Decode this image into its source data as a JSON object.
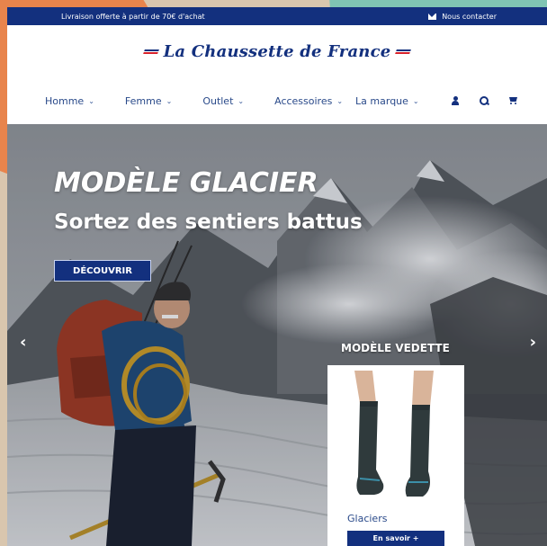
{
  "topbar": {
    "shipping_text": "Livraison offerte à partir de 70€ d'achat",
    "contact_label": "Nous contacter"
  },
  "logo": {
    "text": "La Chaussette de France"
  },
  "nav": {
    "items": [
      {
        "label": "Homme"
      },
      {
        "label": "Femme"
      },
      {
        "label": "Outlet"
      },
      {
        "label": "Accessoires"
      },
      {
        "label": "La marque"
      }
    ],
    "chevron": "⌄"
  },
  "icons": [
    "user-icon",
    "search-icon",
    "cart-icon",
    "mail-icon",
    "chevron-left-icon",
    "chevron-right-icon"
  ],
  "hero": {
    "title": "MODÈLE GLACIER",
    "subtitle": "Sortez des sentiers battus",
    "cta_label": "DÉCOUVRIR",
    "prev_arrow": "‹",
    "next_arrow": "›"
  },
  "featured": {
    "label": "MODÈLE VEDETTE",
    "product_name": "Glaciers",
    "cta_label": "En savoir +"
  },
  "colors": {
    "brand_navy": "#13307e",
    "brand_red": "#d8222a",
    "link_blue": "#2a4a8a"
  }
}
